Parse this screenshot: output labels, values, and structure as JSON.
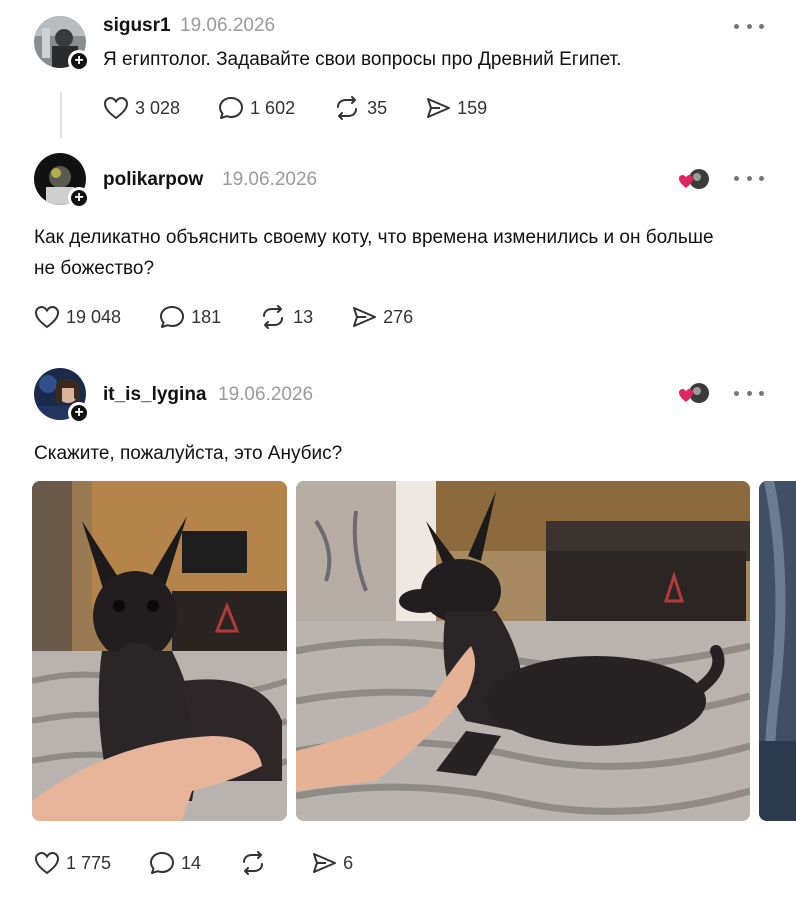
{
  "posts": [
    {
      "username": "sigusr1",
      "date": "19.06.2026",
      "text": "Я египтолог. Задавайте свои вопросы про Древний Египет.",
      "likes": "3 028",
      "replies": "1 602",
      "reposts": "35",
      "shares": "159"
    },
    {
      "username": "polikarpow",
      "date": "19.06.2026",
      "text": "Как деликатно объяснить своему коту, что времена изменились и он больше не божество?",
      "likes": "19 048",
      "replies": "181",
      "reposts": "13",
      "shares": "276"
    },
    {
      "username": "it_is_lygina",
      "date": "19.06.2026",
      "text": "Скажите, пожалуйста, это Анубис?",
      "likes": "1 775",
      "replies": "14",
      "reposts": "",
      "shares": "6"
    }
  ],
  "icons": {
    "like": "heart-icon",
    "reply": "comment-bubble-icon",
    "repost": "repost-arrows-icon",
    "share": "send-icon",
    "more": "more-dots-icon",
    "follow": "plus-icon"
  },
  "colors": {
    "text": "#111111",
    "muted": "#9a9a9a",
    "like_red": "#e0245e",
    "divider": "#e0e0e0"
  }
}
